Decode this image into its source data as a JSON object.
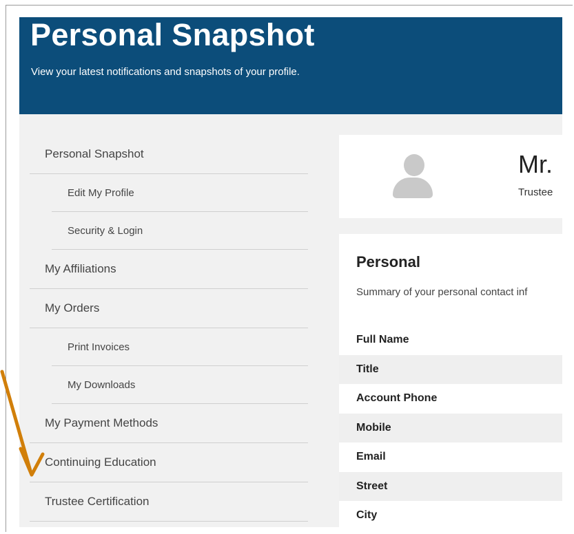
{
  "banner": {
    "title": "Personal Snapshot",
    "subtitle": "View your latest notifications and snapshots of your profile."
  },
  "sidebar": {
    "items": [
      {
        "label": "Personal Snapshot",
        "level": "top"
      },
      {
        "label": "Edit My Profile",
        "level": "sub"
      },
      {
        "label": "Security & Login",
        "level": "sub"
      },
      {
        "label": "My Affiliations",
        "level": "top"
      },
      {
        "label": "My Orders",
        "level": "top"
      },
      {
        "label": "Print Invoices",
        "level": "sub"
      },
      {
        "label": "My Downloads",
        "level": "sub"
      },
      {
        "label": "My Payment Methods",
        "level": "top"
      },
      {
        "label": "Continuing Education",
        "level": "top"
      },
      {
        "label": "Trustee Certification",
        "level": "top"
      }
    ]
  },
  "profile": {
    "name": "Mr.",
    "role": "Trustee"
  },
  "personal": {
    "title": "Personal",
    "description": "Summary of your personal contact inf",
    "fields": [
      "Full Name",
      "Title",
      "Account Phone",
      "Mobile",
      "Email",
      "Street",
      "City"
    ]
  },
  "annotation": {
    "arrow_color": "#d17f0a"
  }
}
